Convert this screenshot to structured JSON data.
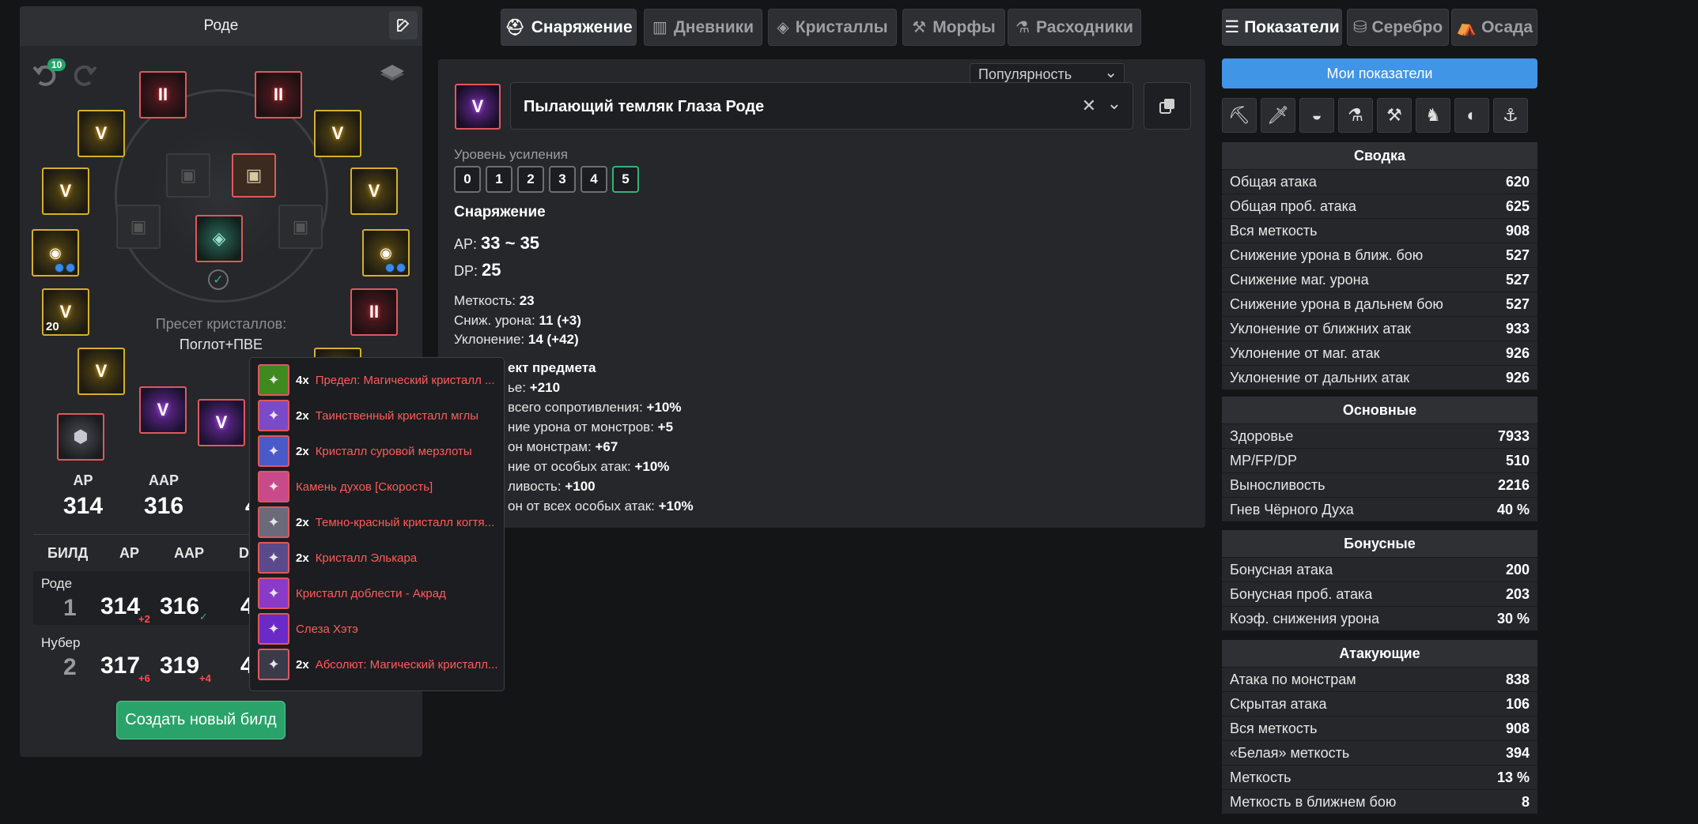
{
  "left_panel": {
    "title": "Роде",
    "undo_count": "10",
    "slot_glyphs": {
      "v": "V",
      "ii": "II",
      "level_badge": "20"
    },
    "crystal_preset_label": "Пресет кристаллов:",
    "crystal_preset_value": "Поглот+ПВЕ",
    "stats": [
      {
        "label": "AP",
        "value": "314"
      },
      {
        "label": "AAP",
        "value": "316"
      },
      {
        "label": "",
        "value": "4"
      }
    ],
    "table_headers": [
      "БИЛД",
      "AP",
      "AAP",
      "D"
    ],
    "builds": [
      {
        "name": "Роде",
        "num": "1",
        "ap": "314",
        "ap_delta": "+2",
        "aap": "316",
        "aap_mark": "✓",
        "dp": "42"
      },
      {
        "name": "Нубер",
        "num": "2",
        "ap": "317",
        "ap_delta": "+6",
        "aap": "319",
        "aap_delta": "+4",
        "dp": "40"
      }
    ],
    "create_button": "Создать новый билд"
  },
  "tabs": [
    {
      "label": "Снаряжение",
      "icon": "armor-icon"
    },
    {
      "label": "Дневники",
      "icon": "books-icon"
    },
    {
      "label": "Кристаллы",
      "icon": "crystal-icon"
    },
    {
      "label": "Морфы",
      "icon": "hammer-icon"
    },
    {
      "label": "Расходники",
      "icon": "potion-icon"
    }
  ],
  "item": {
    "sort_value": "Популярность",
    "name": "Пылающий темляк Глаза Роде",
    "glyph": "V",
    "enhance_label": "Уровень усиления",
    "levels": [
      "0",
      "1",
      "2",
      "3",
      "4",
      "5"
    ],
    "selected_level": "5",
    "equip_heading": "Снаряжение",
    "ap_label": "AP:",
    "ap_value": "33 ~ 35",
    "dp_label": "DP:",
    "dp_value": "25",
    "lines": [
      {
        "label": "Меткость: ",
        "value": "23"
      },
      {
        "label": "Сниж. урона: ",
        "value": "11 (+3)"
      },
      {
        "label": "Уклонение: ",
        "value": "14 (+42)"
      }
    ],
    "effect_heading": "ект предмета",
    "effects": [
      {
        "label": "ье: ",
        "value": "+210"
      },
      {
        "label": "всего сопротивления: ",
        "value": "+10%"
      },
      {
        "label": "ние урона от монстров: ",
        "value": "+5"
      },
      {
        "label": "он монстрам: ",
        "value": "+67"
      },
      {
        "label": "ние от особых атак: ",
        "value": "+10%"
      },
      {
        "label": "ливость: ",
        "value": "+100"
      },
      {
        "label": "он от всех особых атак: ",
        "value": "+10%"
      }
    ]
  },
  "popup": {
    "items": [
      {
        "count": "4x",
        "name": "Предел: Магический кристалл ...",
        "color": "#3e8a1e"
      },
      {
        "count": "2x",
        "name": "Таинственный кристалл мглы",
        "color": "#7a4ac8"
      },
      {
        "count": "2x",
        "name": "Кристалл суровой мерзлоты",
        "color": "#4a5ac8"
      },
      {
        "count": "",
        "name": "Камень духов [Скорость]",
        "color": "#c84a8a"
      },
      {
        "count": "2x",
        "name": "Темно-красный кристалл когтя...",
        "color": "#6a6a7a"
      },
      {
        "count": "2x",
        "name": "Кристалл Элькара",
        "color": "#5a4a8a"
      },
      {
        "count": "",
        "name": "Кристалл доблести - Акрад",
        "color": "#8a3ac8"
      },
      {
        "count": "",
        "name": "Слеза Хэтэ",
        "color": "#6a2ac8"
      },
      {
        "count": "2x",
        "name": "Абсолют: Магический кристалл...",
        "color": "#3a3a4a"
      }
    ]
  },
  "right_tabs": [
    {
      "label": "Показатели",
      "icon": "list-icon"
    },
    {
      "label": "Серебро",
      "icon": "coins-icon"
    },
    {
      "label": "Осада",
      "icon": "tent-icon"
    }
  ],
  "my_stats_button": "Мои показатели",
  "sections": [
    {
      "title": "Сводка",
      "rows": [
        {
          "label": "Общая атака",
          "value": "620"
        },
        {
          "label": "Общая проб. атака",
          "value": "625"
        },
        {
          "label": "Вся меткость",
          "value": "908"
        },
        {
          "label": "Снижение урона в ближ. бою",
          "value": "527"
        },
        {
          "label": "Снижение маг. урона",
          "value": "527"
        },
        {
          "label": "Снижение урона в дальнем бою",
          "value": "527"
        },
        {
          "label": "Уклонение от ближних атак",
          "value": "933"
        },
        {
          "label": "Уклонение от маг. атак",
          "value": "926"
        },
        {
          "label": "Уклонение от дальних атак",
          "value": "926"
        }
      ]
    },
    {
      "title": "Основные",
      "rows": [
        {
          "label": "Здоровье",
          "value": "7933"
        },
        {
          "label": "MP/FP/DP",
          "value": "510"
        },
        {
          "label": "Выносливость",
          "value": "2216"
        },
        {
          "label": "Гнев Чёрного Духа",
          "value": "40 %"
        }
      ]
    },
    {
      "title": "Бонусные",
      "rows": [
        {
          "label": "Бонусная атака",
          "value": "200"
        },
        {
          "label": "Бонусная проб. атака",
          "value": "203"
        },
        {
          "label": "Коэф. снижения урона",
          "value": "30 %"
        }
      ]
    },
    {
      "title": "Атакующие",
      "rows": [
        {
          "label": "Атака по монстрам",
          "value": "838"
        },
        {
          "label": "Скрытая атака",
          "value": "106"
        },
        {
          "label": "Вся меткость",
          "value": "908"
        },
        {
          "label": "«Белая» меткость",
          "value": "394"
        },
        {
          "label": "Меткость",
          "value": "13 %"
        },
        {
          "label": "Меткость в ближнем бою",
          "value": "8"
        }
      ]
    }
  ]
}
